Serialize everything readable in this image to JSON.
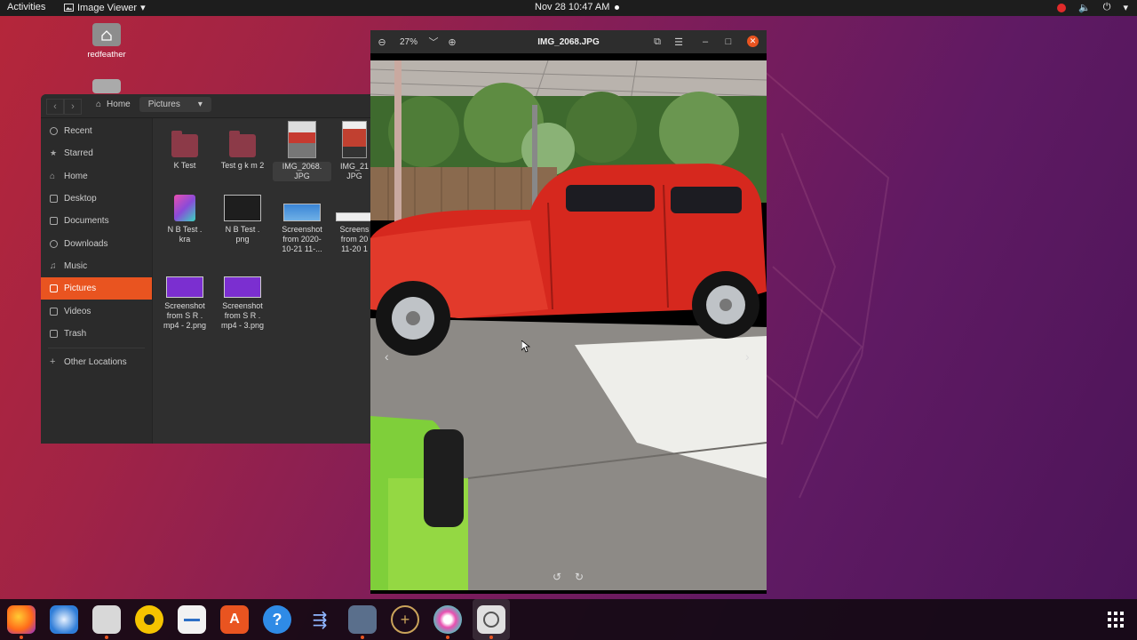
{
  "topbar": {
    "activities": "Activities",
    "app_menu": "Image Viewer",
    "clock": "Nov 28  10:47 AM"
  },
  "desktop": {
    "icons": [
      {
        "label": "redfeather",
        "icon": "home-folder-icon"
      },
      {
        "label": "",
        "icon": "drive-icon"
      }
    ]
  },
  "file_manager": {
    "breadcrumb": [
      "Home",
      "Pictures"
    ],
    "sidebar": [
      {
        "label": "Recent",
        "icon": "clock-icon"
      },
      {
        "label": "Starred",
        "icon": "star-icon"
      },
      {
        "label": "Home",
        "icon": "home-icon"
      },
      {
        "label": "Desktop",
        "icon": "desktop-icon"
      },
      {
        "label": "Documents",
        "icon": "document-icon"
      },
      {
        "label": "Downloads",
        "icon": "download-icon"
      },
      {
        "label": "Music",
        "icon": "music-icon"
      },
      {
        "label": "Pictures",
        "icon": "picture-icon",
        "active": true
      },
      {
        "label": "Videos",
        "icon": "video-icon"
      },
      {
        "label": "Trash",
        "icon": "trash-icon"
      },
      {
        "label": "Other Locations",
        "icon": "plus-icon"
      }
    ],
    "files": [
      {
        "name": "K Test",
        "type": "folder"
      },
      {
        "name": "Test g k m 2",
        "type": "folder"
      },
      {
        "name": "IMG_2068.\nJPG",
        "type": "photo",
        "selected": true
      },
      {
        "name": "IMG_21\nJPG",
        "type": "photo2"
      },
      {
        "name": "N B Test .\nkra",
        "type": "krita"
      },
      {
        "name": "N B Test .\npng",
        "type": "dark"
      },
      {
        "name": "Screenshot\nfrom 2020-\n10-21 11-...",
        "type": "screenshot-blue"
      },
      {
        "name": "Screens\nfrom 20\n11-20 1",
        "type": "screenshot-white"
      },
      {
        "name": "Screenshot\nfrom S R .\nmp4 - 2.png",
        "type": "screenshot-purple"
      },
      {
        "name": "Screenshot\nfrom S R .\nmp4 - 3.png",
        "type": "screenshot-purple"
      }
    ]
  },
  "image_viewer": {
    "title": "IMG_2068.JPG",
    "zoom": "27%"
  },
  "dock": {
    "apps": [
      "firefox-icon",
      "thunderbird-icon",
      "files-icon",
      "rhythmbox-icon",
      "writer-icon",
      "software-icon",
      "help-icon",
      "kdenlive-icon",
      "tv-icon",
      "crosshair-icon",
      "krita-icon",
      "image-viewer-icon"
    ]
  },
  "colors": {
    "accent": "#e95420",
    "car_red": "#d6281e",
    "dock_bg": "#14101a"
  }
}
